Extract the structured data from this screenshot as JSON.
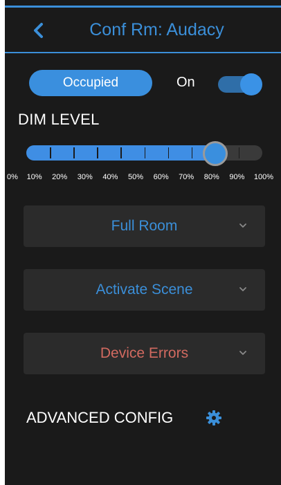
{
  "header": {
    "title": "Conf Rm: Audacy"
  },
  "occupancy": {
    "button_label": "Occupied"
  },
  "power": {
    "label": "On",
    "toggle_on": true
  },
  "dim": {
    "label": "DIM LEVEL",
    "value_percent": 80,
    "ticks": [
      "0%",
      "10%",
      "20%",
      "30%",
      "40%",
      "50%",
      "60%",
      "70%",
      "80%",
      "90%",
      "100%"
    ]
  },
  "accordions": {
    "full_room": "Full Room",
    "activate_scene": "Activate Scene",
    "device_errors": "Device Errors"
  },
  "advanced": {
    "label": "ADVANCED CONFIG"
  },
  "colors": {
    "accent": "#3b8fd9",
    "error": "#d26a60",
    "background": "#1a1a1a",
    "panel": "#2b2b2b"
  },
  "icons": {
    "back": "chevron-left-icon",
    "expand": "chevron-down-icon",
    "settings": "gear-icon"
  }
}
